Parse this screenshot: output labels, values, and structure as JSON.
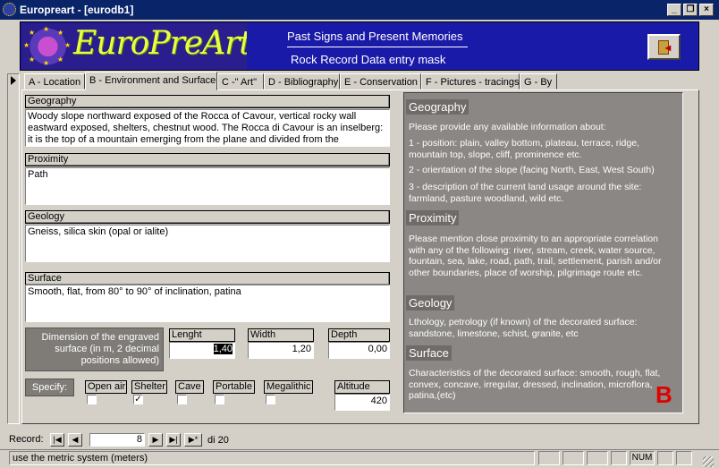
{
  "window": {
    "title": "Europreart - [eurodb1]",
    "buttons": {
      "minimize": "_",
      "restore": "❐",
      "close": "×"
    }
  },
  "header": {
    "logo_text": "EuroPreArt",
    "line1": "Past Signs and Present Memories",
    "line2": "Rock Record Data entry mask",
    "exit_icon": "exit-door-icon"
  },
  "tabs": [
    {
      "label": "A - Location"
    },
    {
      "label": "B - Environment and Surface"
    },
    {
      "label": "C -\" Art\""
    },
    {
      "label": "D - Bibliography"
    },
    {
      "label": "E - Conservation"
    },
    {
      "label": "F - Pictures - tracings"
    },
    {
      "label": "G - By"
    }
  ],
  "form": {
    "geography": {
      "label": "Geography",
      "value": "Woody slope northward exposed of the Rocca of Cavour, vertical rocky wall eastward exposed, shelters, chestnut wood. The Rocca di Cavour is an inselberg: it is the top of a mountain emerging from the plane and divided from the"
    },
    "proximity": {
      "label": "Proximity",
      "value": "Path"
    },
    "geology": {
      "label": "Geology",
      "value": "Gneiss, silica skin (opal or ialite)"
    },
    "surface": {
      "label": "Surface",
      "value": "Smooth, flat, from 80° to 90° of inclination, patina"
    },
    "dimension_note": "Dimension of the engraved surface (in m, 2 decimal positions allowed)",
    "lenght": {
      "label": "Lenght",
      "value": "1,40"
    },
    "width": {
      "label": "Width",
      "value": "1,20"
    },
    "depth": {
      "label": "Depth",
      "value": "0,00"
    },
    "specify_label": "Specify:",
    "checks": [
      {
        "label": "Open air",
        "checked": false
      },
      {
        "label": "Shelter",
        "checked": true
      },
      {
        "label": "Cave",
        "checked": false
      },
      {
        "label": "Portable",
        "checked": false
      },
      {
        "label": "Megalithic",
        "checked": false
      }
    ],
    "check_mark": "✓",
    "altitude": {
      "label": "Altitude",
      "value": "420"
    }
  },
  "help": {
    "geo_head": "Geography",
    "geo_intro": "Please provide any available information about:",
    "geo_1": "1 - position: plain, valley bottom, plateau, terrace, ridge, mountain top, slope, cliff, prominence etc.",
    "geo_2": "2 - orientation of the slope (facing North, East, West South)",
    "geo_3": "3 - description of the current land usage around the site: farmland, pasture woodland, wild  etc.",
    "prox_head": "Proximity",
    "prox_text": "Please mention close proximity to an appropriate correlation with any of the following: river, stream, creek, water source, fountain, sea, lake, road, path, trail, settlement, parish and/or other boundaries, place of worship, pilgrimage route etc.",
    "geol_head": "Geology",
    "geol_text": "Lthology, petrology (if known) of the decorated surface: sandstone, limestone, schist, granite, etc",
    "surf_head": "Surface",
    "surf_text": "Characteristics of the decorated surface: smooth, rough, flat, convex, concave, irregular, dressed, inclination, microflora, patina,(etc)",
    "section_letter": "B"
  },
  "navigation": {
    "record_label": "Record:",
    "current": "8",
    "of_label": "di 20",
    "first": "|◀",
    "prev": "◀",
    "next": "▶",
    "last": "▶|",
    "new": "▶*"
  },
  "status": {
    "text": "use the metric system (meters)",
    "num": "NUM"
  }
}
